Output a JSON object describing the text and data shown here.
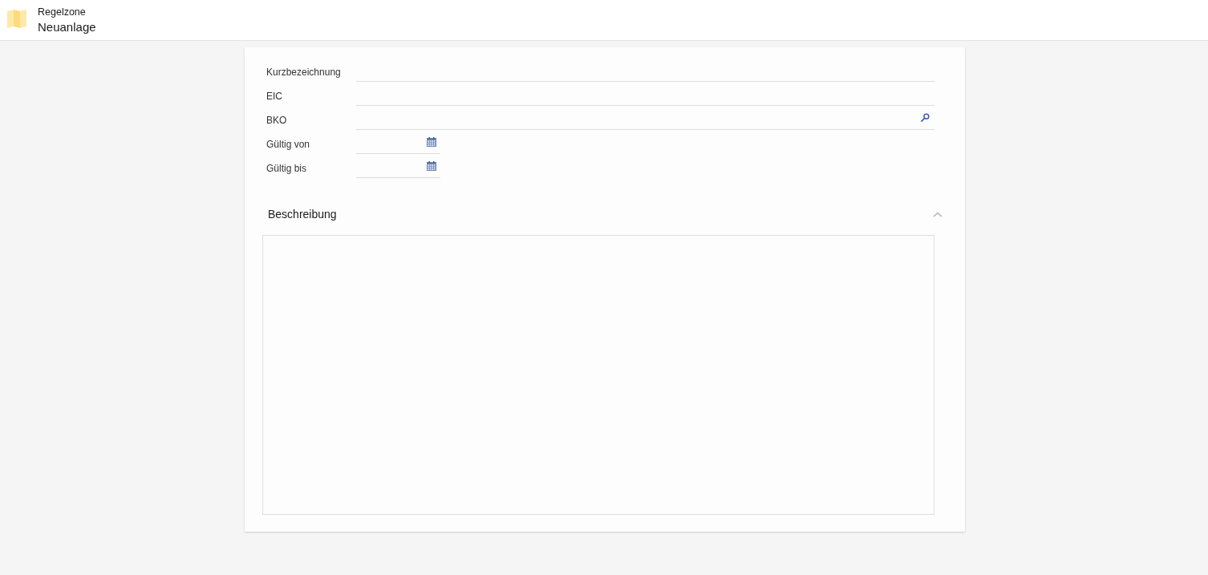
{
  "header": {
    "title": "Regelzone",
    "subtitle": "Neuanlage"
  },
  "fields": [
    {
      "label": "Kurzbezeichnung",
      "kind": "text"
    },
    {
      "label": "EIC",
      "kind": "text"
    },
    {
      "label": "BKO",
      "kind": "lookup"
    },
    {
      "label": "Gültig von",
      "kind": "date"
    },
    {
      "label": "Gültig bis",
      "kind": "date"
    }
  ],
  "description": {
    "title": "Beschreibung",
    "expanded": true
  }
}
